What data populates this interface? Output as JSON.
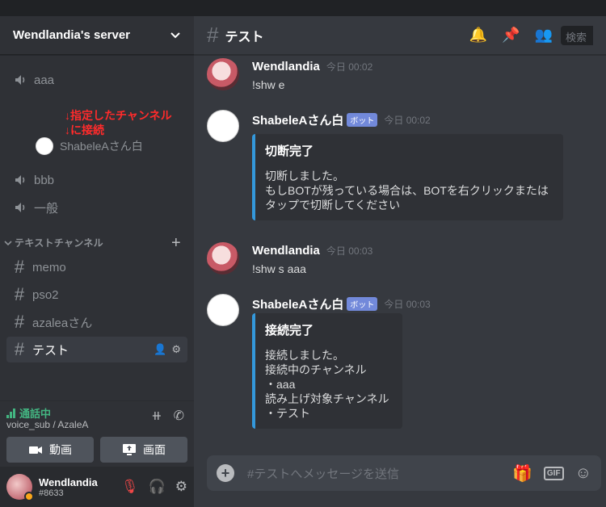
{
  "server": {
    "name": "Wendlandia's server"
  },
  "voice_channels": [
    {
      "name": "aaa"
    },
    {
      "name": "bbb"
    },
    {
      "name": "一般"
    }
  ],
  "annotation": {
    "line1": "↓指定したチャンネル",
    "line2": "↓に接続"
  },
  "voice_user": {
    "name": "ShabeleAさん白"
  },
  "category": {
    "label": "テキストチャンネル",
    "add": "+"
  },
  "text_channels": [
    {
      "name": "memo"
    },
    {
      "name": "pso2"
    },
    {
      "name": "azaleaさん"
    },
    {
      "name": "テスト",
      "active": true
    }
  ],
  "voice_panel": {
    "status": "通話中",
    "sub": "voice_sub / AzaleA",
    "video_label": "動画",
    "screen_label": "画面"
  },
  "user": {
    "name": "Wendlandia",
    "tag": "#8633"
  },
  "channel_header": {
    "hash": "#",
    "title": "テスト",
    "search_placeholder": "検索"
  },
  "messages": [
    {
      "author": "Wendlandia",
      "time": "今日 00:02",
      "text": "!shw e"
    },
    {
      "author": "ShabeleAさん白",
      "badge": "ボット",
      "time": "今日 00:02",
      "embed": {
        "title": "切断完了",
        "description": "切断しました。\nもしBOTが残っている場合は、BOTを右クリックまたは\nタップで切断してください"
      }
    },
    {
      "author": "Wendlandia",
      "time": "今日 00:03",
      "text": "!shw s aaa"
    },
    {
      "author": "ShabeleAさん白",
      "badge": "ボット",
      "time": "今日 00:03",
      "embed": {
        "title": "接続完了",
        "description": "接続しました。\n接続中のチャンネル\n・aaa\n読み上げ対象チャンネル\n・テスト"
      }
    }
  ],
  "composer": {
    "placeholder": "#テストへメッセージを送信",
    "gif": "GIF"
  },
  "colors": {
    "accent": "#7289da",
    "embed_border": "#3498db",
    "online": "#43b581",
    "annotation": "#ff2b2b"
  },
  "icons": [
    "chevron-down-icon",
    "speaker-icon",
    "hash-icon",
    "add-member-icon",
    "gear-icon",
    "bell-icon",
    "pin-icon",
    "members-icon",
    "signal-icon",
    "disconnect-icon",
    "camera-icon",
    "screen-share-icon",
    "mic-muted-icon",
    "headphones-icon",
    "gift-icon",
    "gif-icon",
    "emoji-icon"
  ]
}
